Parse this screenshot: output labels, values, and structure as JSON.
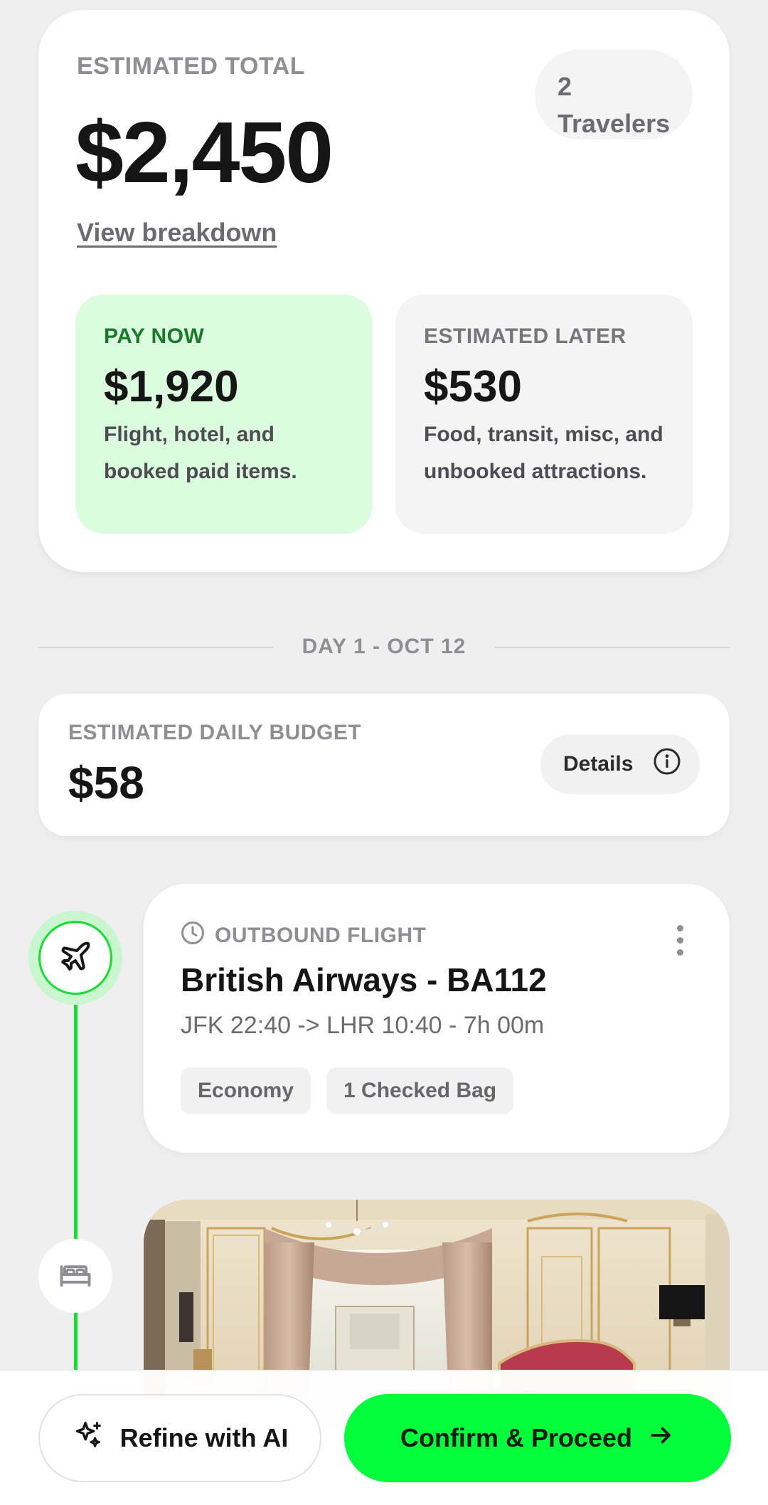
{
  "summary": {
    "label": "ESTIMATED TOTAL",
    "total": "$2,450",
    "view_breakdown": "View breakdown",
    "travelers_count": "2",
    "travelers_label": "Travelers",
    "pay_now": {
      "label": "PAY NOW",
      "amount": "$1,920",
      "desc_line1": "Flight, hotel, and",
      "desc_line2": "booked paid items."
    },
    "pay_later": {
      "label": "ESTIMATED LATER",
      "amount": "$530",
      "desc_line1": "Food, transit, misc, and",
      "desc_line2": "unbooked attractions."
    }
  },
  "day": {
    "label": "DAY 1 - OCT 12"
  },
  "budget": {
    "label": "ESTIMATED DAILY BUDGET",
    "amount": "$58",
    "details_label": "Details"
  },
  "flight": {
    "type_label": "OUTBOUND FLIGHT",
    "title": "British Airways - BA112",
    "route": "JFK 22:40 -> LHR 10:40 - 7h 00m",
    "tags": [
      "Economy",
      "1 Checked Bag"
    ]
  },
  "actions": {
    "refine_label": "Refine with AI",
    "confirm_label": "Confirm & Proceed"
  },
  "colors": {
    "accent": "#00ff3a",
    "timeline": "#14e030",
    "pay_now_bg": "#dcfce0",
    "pay_now_text": "#197a2a"
  },
  "icons": {
    "flight_node": "plane-icon",
    "hotel_node": "bed-icon",
    "flight_type": "clock-icon",
    "details": "info-icon",
    "refine": "sparkle-icon",
    "confirm": "arrow-right-icon"
  }
}
